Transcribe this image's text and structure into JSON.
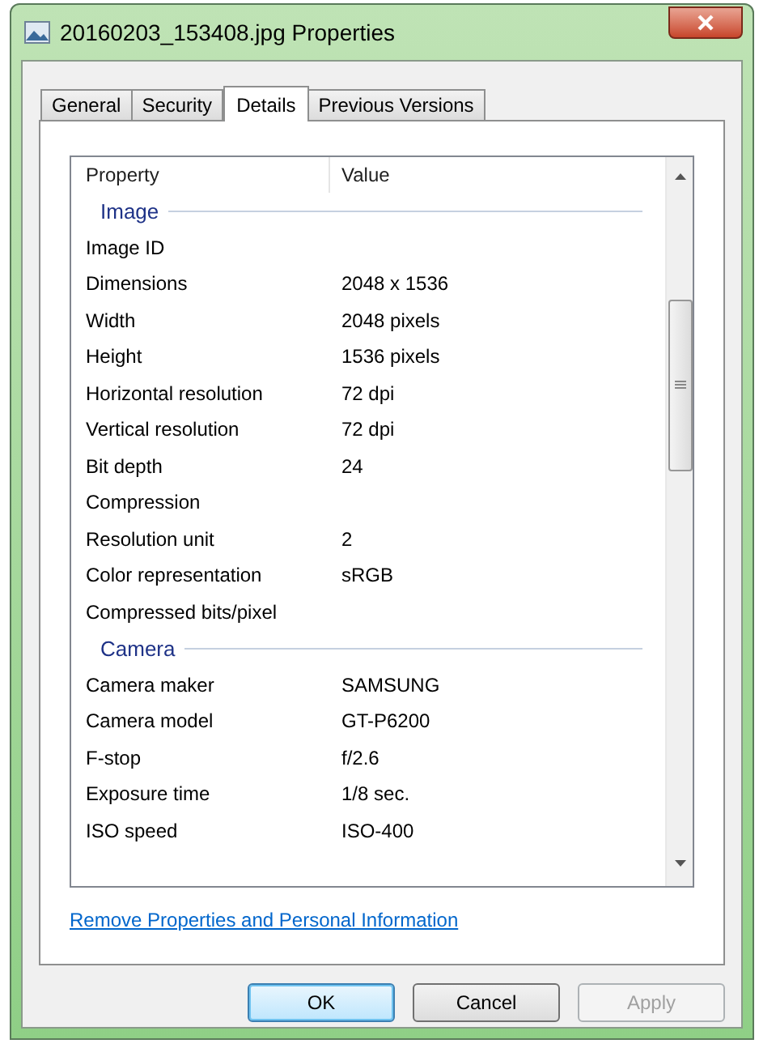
{
  "window": {
    "title": "20160203_153408.jpg Properties"
  },
  "tabs": [
    {
      "label": "General",
      "selected": false
    },
    {
      "label": "Security",
      "selected": false
    },
    {
      "label": "Details",
      "selected": true
    },
    {
      "label": "Previous Versions",
      "selected": false
    }
  ],
  "table": {
    "columns": [
      "Property",
      "Value"
    ],
    "rows": [
      {
        "kind": "group",
        "name": "Image"
      },
      {
        "kind": "property",
        "name": "Image ID",
        "value": ""
      },
      {
        "kind": "property",
        "name": "Dimensions",
        "value": "2048 x 1536"
      },
      {
        "kind": "property",
        "name": "Width",
        "value": "2048 pixels"
      },
      {
        "kind": "property",
        "name": "Height",
        "value": "1536 pixels"
      },
      {
        "kind": "property",
        "name": "Horizontal resolution",
        "value": "72 dpi"
      },
      {
        "kind": "property",
        "name": "Vertical resolution",
        "value": "72 dpi"
      },
      {
        "kind": "property",
        "name": "Bit depth",
        "value": "24"
      },
      {
        "kind": "property",
        "name": "Compression",
        "value": ""
      },
      {
        "kind": "property",
        "name": "Resolution unit",
        "value": "2"
      },
      {
        "kind": "property",
        "name": "Color representation",
        "value": "sRGB"
      },
      {
        "kind": "property",
        "name": "Compressed bits/pixel",
        "value": ""
      },
      {
        "kind": "group",
        "name": "Camera"
      },
      {
        "kind": "property",
        "name": "Camera maker",
        "value": "SAMSUNG"
      },
      {
        "kind": "property",
        "name": "Camera model",
        "value": "GT-P6200"
      },
      {
        "kind": "property",
        "name": "F-stop",
        "value": "f/2.6"
      },
      {
        "kind": "property",
        "name": "Exposure time",
        "value": "1/8 sec."
      },
      {
        "kind": "property",
        "name": "ISO speed",
        "value": "ISO-400"
      }
    ]
  },
  "link": "Remove Properties and Personal Information",
  "buttons": [
    {
      "label": "OK",
      "disabled": false,
      "default": true
    },
    {
      "label": "Cancel",
      "disabled": false,
      "default": false
    },
    {
      "label": "Apply",
      "disabled": true,
      "default": false
    }
  ]
}
